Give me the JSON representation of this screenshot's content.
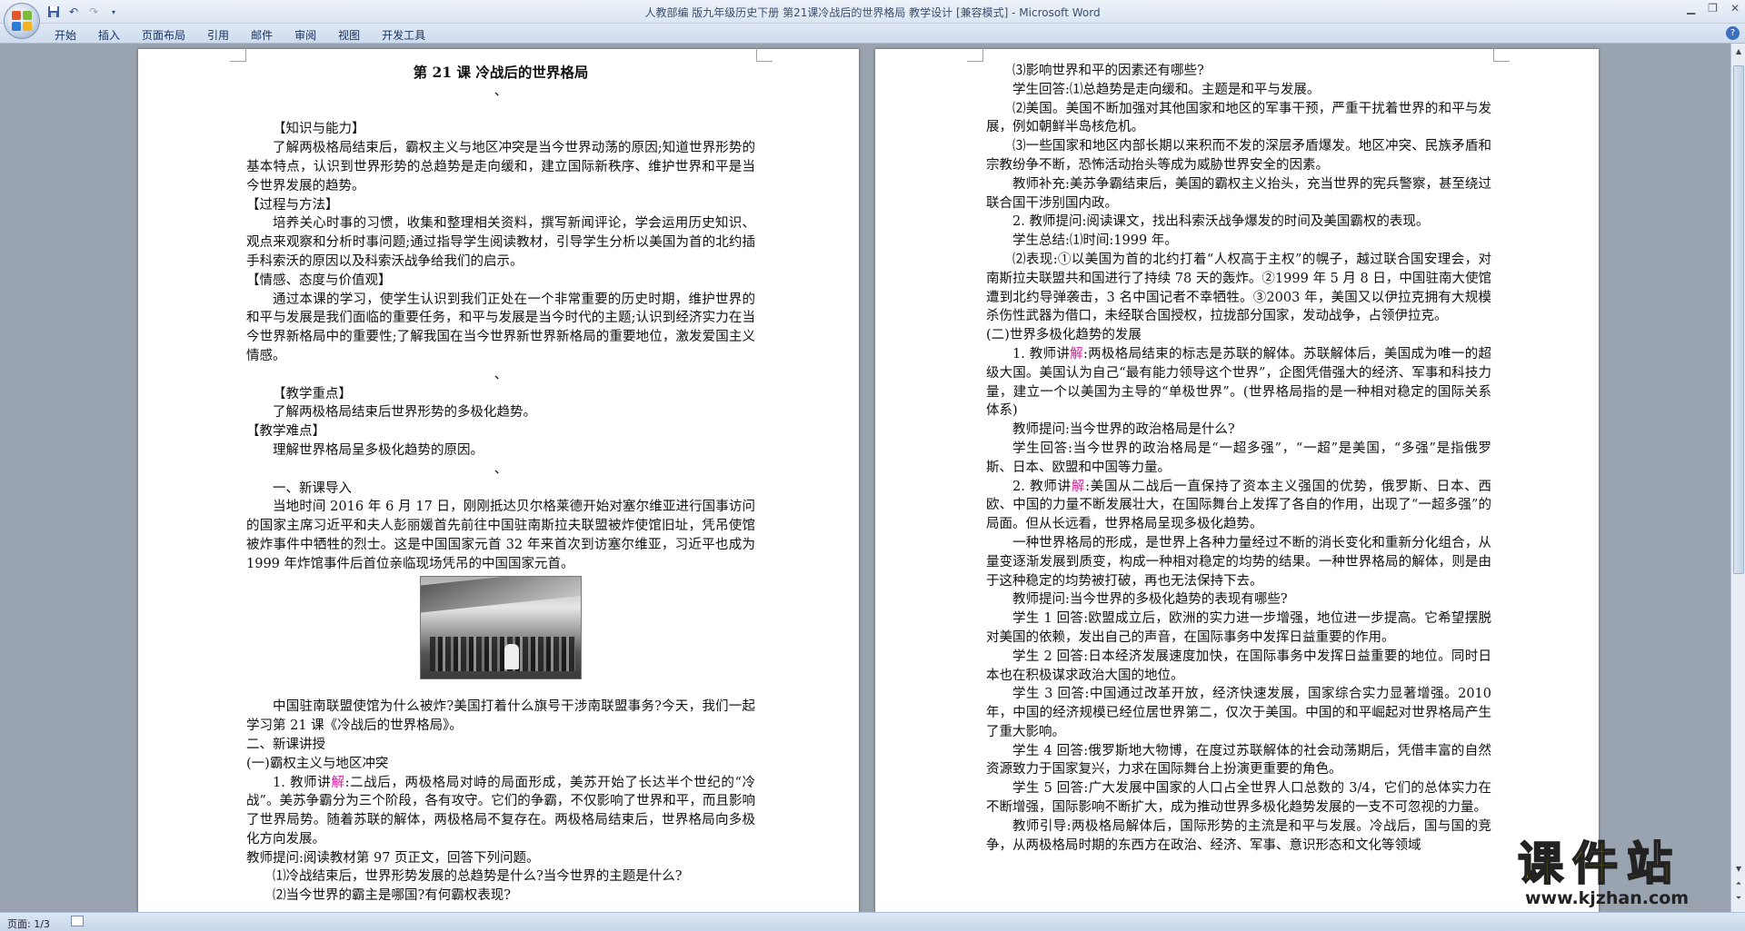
{
  "window": {
    "title": "人教部编 版九年级历史下册  第21课冷战后的世界格局  教学设计 [兼容模式] - Microsoft Word"
  },
  "ribbon": {
    "tabs": [
      "开始",
      "插入",
      "页面布局",
      "引用",
      "邮件",
      "审阅",
      "视图",
      "开发工具"
    ]
  },
  "status": {
    "pages": "页面: 1/3"
  },
  "watermark": {
    "text": "课件站",
    "url": "www.kjzhan.com"
  },
  "page1": {
    "title": "第 21 课   冷战后的世界格局",
    "h_knowledge": "【知识与能力】",
    "p_knowledge": "了解两极格局结束后，霸权主义与地区冲突是当今世界动荡的原因;知道世界形势的基本特点，认识到世界形势的总趋势是走向缓和，建立国际新秩序、维护世界和平是当今世界发展的趋势。",
    "h_process": "【过程与方法】",
    "p_process": "培养关心时事的习惯，收集和整理相关资料，撰写新闻评论，学会运用历史知识、观点来观察和分析时事问题;通过指导学生阅读教材，引导学生分析以美国为首的北约插手科索沃的原因以及科索沃战争给我们的启示。",
    "h_emotion": "【情感、态度与价值观】",
    "p_emotion": "通过本课的学习，使学生认识到我们正处在一个非常重要的历史时期，维护世界的和平与发展是我们面临的重要任务，和平与发展是当今时代的主题;认识到经济实力在当今世界新格局中的重要性;了解我国在当今世界新世界新格局的重要地位，激发爱国主义情感。",
    "h_key": "【教学重点】",
    "p_key": "了解两极格局结束后世界形势的多极化趋势。",
    "h_difficulty": "【教学难点】",
    "p_difficulty": "理解世界格局呈多极化趋势的原因。",
    "h_intro": "一、新课导入",
    "p_intro": "当地时间 2016 年 6 月 17 日，刚刚抵达贝尔格莱德开始对塞尔维亚进行国事访问的国家主席习近平和夫人彭丽媛首先前往中国驻南斯拉夫联盟被炸使馆旧址，凭吊使馆被炸事件中牺牲的烈士。这是中国国家元首 32 年来首次到访塞尔维亚，习近平也成为 1999 年炸馆事件后首位亲临现场凭吊的中国国家元首。",
    "p_question": "中国驻南联盟使馆为什么被炸?美国打着什么旗号干涉南联盟事务?今天，我们一起学习第 21 课《冷战后的世界格局》。",
    "h_new": "二、新课讲授",
    "h_sub1": "(一)霸权主义与地区冲突",
    "p1_pre": "1. 教师讲",
    "p1_pink": "解",
    "p1_post": ":二战后，两极格局对峙的局面形成，美苏开始了长达半个世纪的“冷战”。美苏争霸分为三个阶段，各有攻守。它们的争霸，不仅影响了世界和平，而且影响了世界局势。随着苏联的解体，两极格局不复存在。两极格局结束后，世界格局向多极化方向发展。",
    "p_teacher_q": "教师提问:阅读教材第 97 页正文，回答下列问题。",
    "q1": "⑴冷战结束后，世界形势发展的总趋势是什么?当今世界的主题是什么?",
    "q2": "⑵当今世界的霸主是哪国?有何霸权表现?"
  },
  "page2": {
    "q3": "⑶影响世界和平的因素还有哪些?",
    "a1": "学生回答:⑴总趋势是走向缓和。主题是和平与发展。",
    "a2": "⑵美国。美国不断加强对其他国家和地区的军事干预，严重干扰着世界的和平与发展，例如朝鲜半岛核危机。",
    "a3": "⑶一些国家和地区内部长期以来积而不发的深层矛盾爆发。地区冲突、民族矛盾和宗教纷争不断，恐怖活动抬头等成为威胁世界安全的因素。",
    "supp": "教师补充:美苏争霸结束后，美国的霸权主义抬头，充当世界的宪兵警察，甚至绕过联合国干涉别国内政。",
    "t2": "2. 教师提问:阅读课文，找出科索沃战争爆发的时间及美国霸权的表现。",
    "s_sum": "学生总结:⑴时间:1999 年。",
    "s_sum2": "⑵表现:①以美国为首的北约打着“人权高于主权”的幌子，越过联合国安理会，对南斯拉夫联盟共和国进行了持续 78 天的轰炸。②1999 年 5 月 8 日，中国驻南大使馆遭到北约导弹袭击，3 名中国记者不幸牺牲。③2003 年，美国又以伊拉克拥有大规模杀伤性武器为借口，未经联合国授权，拉拢部分国家，发动战争，占领伊拉克。",
    "h_sub2": "(二)世界多极化趋势的发展",
    "p3_pre": "1. 教师讲",
    "p3_pink": "解",
    "p3_post": ":两极格局结束的标志是苏联的解体。苏联解体后，美国成为唯一的超级大国。美国认为自己“最有能力领导这个世界”，企图凭借强大的经济、军事和科技力量，建立一个以美国为主导的“单极世界”。(世界格局指的是一种相对稳定的国际关系体系)",
    "q_pol": "教师提问:当今世界的政治格局是什么?",
    "a_pol": "学生回答:当今世界的政治格局是“一超多强”，“一超”是美国，“多强”是指俄罗斯、日本、欧盟和中国等力量。",
    "p4_pre": "2. 教师讲",
    "p4_pink": "解",
    "p4_post": ":美国从二战后一直保持了资本主义强国的优势，俄罗斯、日本、西欧、中国的力量不断发展壮大，在国际舞台上发挥了各自的作用，出现了“一超多强”的局面。但从长远看，世界格局呈现多极化趋势。",
    "p_form": "一种世界格局的形成，是世界上各种力量经过不断的消长变化和重新分化组合，从量变逐渐发展到质变，构成一种相对稳定的均势的结果。一种世界格局的解体，则是由于这种稳定的均势被打破，再也无法保持下去。",
    "q_multi": "教师提问:当今世界的多极化趋势的表现有哪些?",
    "s1": "学生 1 回答:欧盟成立后，欧洲的实力进一步增强，地位进一步提高。它希望摆脱对美国的依赖，发出自己的声音，在国际事务中发挥日益重要的作用。",
    "s2": "学生 2 回答:日本经济发展速度加快，在国际事务中发挥日益重要的地位。同时日本也在积极谋求政治大国的地位。",
    "s3": "学生 3 回答:中国通过改革开放，经济快速发展，国家综合实力显著增强。2010 年，中国的经济规模已经位居世界第二，仅次于美国。中国的和平崛起对世界格局产生了重大影响。",
    "s4": "学生 4 回答:俄罗斯地大物博，在度过苏联解体的社会动荡期后，凭借丰富的自然资源致力于国家复兴，力求在国际舞台上扮演更重要的角色。",
    "s5": "学生 5 回答:广大发展中国家的人口占全世界人口总数的 3/4，它们的总体实力在不断增强，国际影响不断扩大，成为推动世界多极化趋势发展的一支不可忽视的力量。",
    "guide": "教师引导:两极格局解体后，国际形势的主流是和平与发展。冷战后，国与国的竞争，从两极格局时期的东西方在政治、经济、军事、意识形态和文化等领域"
  }
}
